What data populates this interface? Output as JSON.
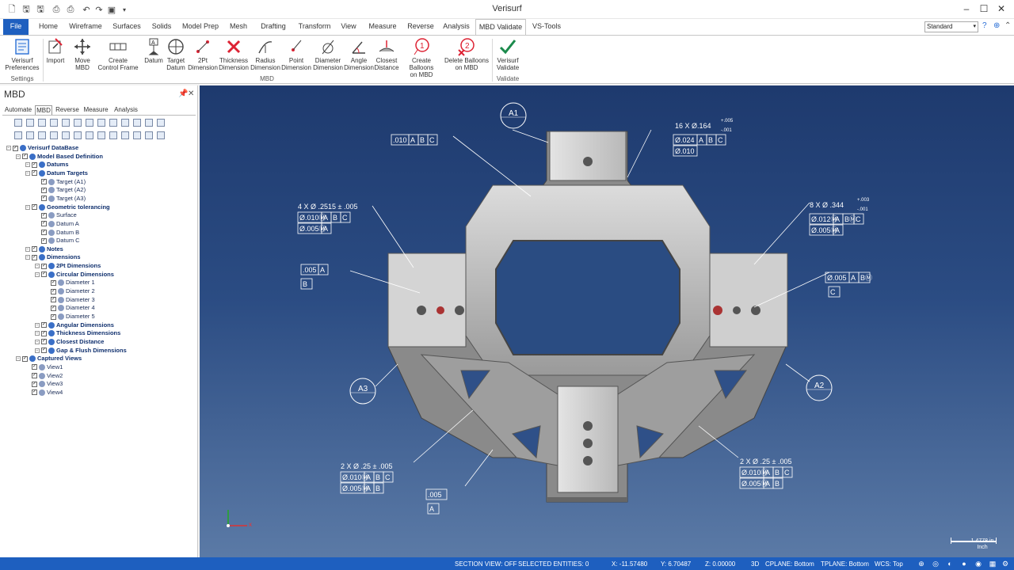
{
  "app": {
    "title": "Verisurf"
  },
  "menu_tabs": [
    "File",
    "Home",
    "Wireframe",
    "Surfaces",
    "Solids",
    "Model Prep",
    "Mesh",
    "Drafting",
    "Transform",
    "View",
    "Measure",
    "Reverse",
    "Analysis",
    "MBD Validate",
    "VS-Tools"
  ],
  "style_select": {
    "value": "Standard"
  },
  "ribbon": {
    "buttons": [
      {
        "id": "verisurf-preferences",
        "label": "Verisurf\nPreferences"
      },
      {
        "id": "import",
        "label": "Import"
      },
      {
        "id": "move-mbd",
        "label": "Move\nMBD"
      },
      {
        "id": "create-control-frame",
        "label": "Create\nControl Frame"
      },
      {
        "id": "datum",
        "label": "Datum"
      },
      {
        "id": "target-datum",
        "label": "Target\nDatum"
      },
      {
        "id": "2pt-dimension",
        "label": "2Pt\nDimension"
      },
      {
        "id": "thickness-dimension",
        "label": "Thickness\nDimension"
      },
      {
        "id": "radius-dimension",
        "label": "Radius\nDimension"
      },
      {
        "id": "point-dimension",
        "label": "Point\nDimension"
      },
      {
        "id": "diameter-dimension",
        "label": "Diameter\nDimension"
      },
      {
        "id": "angle-dimension",
        "label": "Angle\nDimension"
      },
      {
        "id": "closest-distance",
        "label": "Closest\nDistance"
      },
      {
        "id": "create-balloons",
        "label": "Create Balloons\non MBD"
      },
      {
        "id": "delete-balloons",
        "label": "Delete Balloons\non MBD"
      },
      {
        "id": "verisurf-validate",
        "label": "Verisurf\nValidate"
      }
    ],
    "groups": [
      "Settings",
      "MBD",
      "Validate"
    ]
  },
  "panel": {
    "title": "MBD",
    "tabs": [
      "Automate",
      "MBD",
      "Reverse",
      "Measure",
      "Analysis"
    ],
    "pin": "ᵖ",
    "close": "✕"
  },
  "tree": [
    {
      "label": "Verisurf DataBase",
      "bold": true
    },
    {
      "label": "Model Based Definition",
      "bold": true
    },
    {
      "label": "Datums",
      "bold": true
    },
    {
      "label": "Datum Targets",
      "bold": true
    },
    {
      "label": "Target (A1)",
      "bold": false
    },
    {
      "label": "Target (A2)",
      "bold": false
    },
    {
      "label": "Target (A3)",
      "bold": false
    },
    {
      "label": "Geometric tolerancing",
      "bold": true
    },
    {
      "label": "Surface",
      "bold": false
    },
    {
      "label": "Datum A",
      "bold": false
    },
    {
      "label": "Datum B",
      "bold": false
    },
    {
      "label": "Datum C",
      "bold": false
    },
    {
      "label": "Notes",
      "bold": true
    },
    {
      "label": "Dimensions",
      "bold": true
    },
    {
      "label": "2Pt Dimensions",
      "bold": true
    },
    {
      "label": "Circular Dimensions",
      "bold": true
    },
    {
      "label": "Diameter 1",
      "bold": false
    },
    {
      "label": "Diameter 2",
      "bold": false
    },
    {
      "label": "Diameter 3",
      "bold": false
    },
    {
      "label": "Diameter 4",
      "bold": false
    },
    {
      "label": "Diameter 5",
      "bold": false
    },
    {
      "label": "Angular Dimensions",
      "bold": true
    },
    {
      "label": "Thickness Dimensions",
      "bold": true
    },
    {
      "label": "Closest Distance",
      "bold": true
    },
    {
      "label": "Gap & Flush Dimensions",
      "bold": true
    },
    {
      "label": "Captured Views",
      "bold": true
    },
    {
      "label": "View1",
      "bold": false
    },
    {
      "label": "View2",
      "bold": false
    },
    {
      "label": "View3",
      "bold": false
    },
    {
      "label": "View4",
      "bold": false
    }
  ],
  "viewport": {
    "balloons": [
      "A1",
      "A2",
      "A3"
    ],
    "callouts": {
      "top_fcf": [
        ".010",
        "A",
        "B",
        "C"
      ],
      "hole16": {
        "text": "16 X Ø.164",
        "tol_plus": "+.005",
        "tol_minus": "-.001",
        "row1": [
          "Ø.024",
          "A",
          "B",
          "C"
        ],
        "row2": [
          "Ø.010"
        ]
      },
      "hole4": {
        "text": "4 X Ø .2515 ± .005",
        "row1": [
          "Ø.010Ⓜ",
          "A",
          "B",
          "C"
        ],
        "row2": [
          "Ø.005Ⓜ",
          "A"
        ]
      },
      "hole8": {
        "text": "8 X Ø .344",
        "tol_plus": "+.003",
        "tol_minus": "-.001",
        "row1": [
          "Ø.012Ⓜ",
          "A",
          "BⓂ",
          "C"
        ],
        "row2": [
          "Ø.005Ⓜ",
          "A"
        ]
      },
      "perp_b": {
        "row": [
          ".005",
          "A"
        ],
        "datum": "B"
      },
      "pos_c": {
        "row": [
          "Ø.005",
          "A",
          "BⓂ"
        ],
        "datum": "C"
      },
      "hole2_left": {
        "text": "2 X Ø .25 ± .005",
        "row1": [
          "Ø.010Ⓜ",
          "A",
          "B",
          "C"
        ],
        "row2": [
          "Ø.005Ⓜ",
          "A",
          "B"
        ]
      },
      "flat_a": {
        "row": [
          ".005"
        ],
        "datum": "A"
      },
      "hole2_right": {
        "text": "2 X Ø .25 ± .005",
        "row1": [
          "Ø.010Ⓜ",
          "A",
          "B",
          "C"
        ],
        "row2": [
          "Ø.005Ⓜ",
          "A",
          "B"
        ]
      }
    },
    "scale": {
      "value": "1.4778 in",
      "unit": "Inch"
    },
    "axes": {
      "x": "x"
    }
  },
  "status": {
    "section_view": "SECTION VIEW: OFF",
    "selected": "SELECTED ENTITIES: 0",
    "x": "X:   -11.57480",
    "y": "Y:   6.70487",
    "z": "Z:   0.00000",
    "mode": "3D",
    "cplane": "CPLANE: Bottom",
    "tplane": "TPLANE: Bottom",
    "wcs": "WCS: Top"
  },
  "colors": {
    "accent": "#1e5fbf",
    "viewport_top": "#1e3a6e",
    "viewport_bottom": "#5b7aa6"
  }
}
